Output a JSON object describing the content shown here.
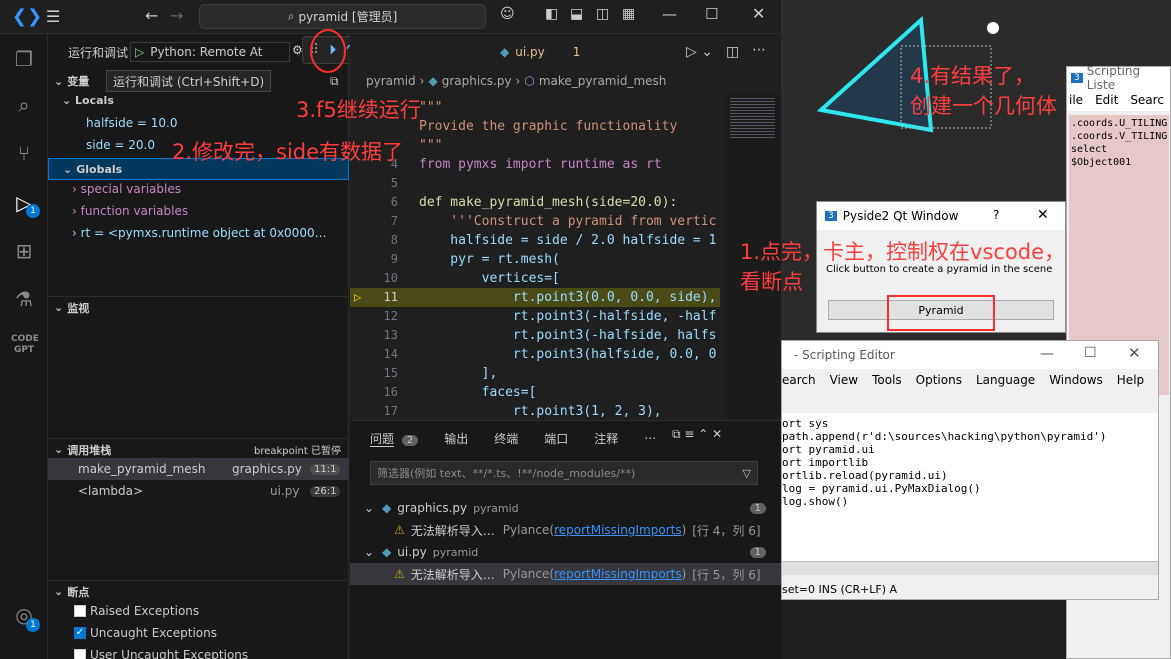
{
  "titlebar": {
    "search_text": "pyramid [管理员]"
  },
  "debug": {
    "run_label": "运行和调试",
    "config": "Python: Remote At",
    "tooltip": "运行和调试 (Ctrl+Shift+D)"
  },
  "variables": {
    "title": "变量",
    "locals_title": "Locals",
    "halfside": "halfside = 10.0",
    "side": "side = 20.0",
    "globals_title": "Globals",
    "special": "special variables",
    "function": "function variables",
    "rt": "rt = <pymxs.runtime object at 0x0000…"
  },
  "watch": {
    "title": "监视"
  },
  "callstack": {
    "title": "调用堆栈",
    "status": "breakpoint 已暂停",
    "frames": [
      {
        "name": "make_pyramid_mesh",
        "file": "graphics.py",
        "line": "11:1"
      },
      {
        "name": "<lambda>",
        "file": "ui.py",
        "line": "26:1"
      }
    ]
  },
  "breakpoints": {
    "title": "断点",
    "items": [
      "Raised Exceptions",
      "Uncaught Exceptions",
      "User Uncaught Exceptions"
    ]
  },
  "editor": {
    "tab": "ui.py",
    "tab_num": "1",
    "breadcrumb": [
      "pyramid",
      "graphics.py",
      "make_pyramid_mesh"
    ],
    "lines": [
      {
        "n": "",
        "t": "\"\"\""
      },
      {
        "n": "",
        "t": "Provide the graphic functionality"
      },
      {
        "n": "",
        "t": "\"\"\""
      },
      {
        "n": "4",
        "t": "from pymxs import runtime as rt"
      },
      {
        "n": "5",
        "t": ""
      },
      {
        "n": "6",
        "t": "def make_pyramid_mesh(side=20.0):"
      },
      {
        "n": "7",
        "t": "    '''Construct a pyramid from vertic"
      },
      {
        "n": "8",
        "t": "    halfside = side / 2.0 halfside = 1"
      },
      {
        "n": "9",
        "t": "    pyr = rt.mesh("
      },
      {
        "n": "10",
        "t": "        vertices=["
      },
      {
        "n": "11",
        "t": "            rt.point3(0.0, 0.0, side),"
      },
      {
        "n": "12",
        "t": "            rt.point3(-halfside, -half"
      },
      {
        "n": "13",
        "t": "            rt.point3(-halfside, halfs"
      },
      {
        "n": "14",
        "t": "            rt.point3(halfside, 0.0, 0"
      },
      {
        "n": "15",
        "t": "        ],"
      },
      {
        "n": "16",
        "t": "        faces=["
      },
      {
        "n": "17",
        "t": "            rt.point3(1, 2, 3),"
      }
    ]
  },
  "panel": {
    "tabs": [
      "问题",
      "输出",
      "终端",
      "端口",
      "注释"
    ],
    "badge": "2",
    "filter": "筛选器(例如 text、**/*.ts、!**/node_modules/**)",
    "groups": [
      {
        "file": "graphics.py",
        "folder": "pyramid",
        "count": "1",
        "msg": "无法解析导入…",
        "src": "Pylance",
        "code": "reportMissingImports",
        "pos": "[行 4，列 6]"
      },
      {
        "file": "ui.py",
        "folder": "pyramid",
        "count": "1",
        "msg": "无法解析导入…",
        "src": "Pylance",
        "code": "reportMissingImports",
        "pos": "[行 5，列 6]"
      }
    ]
  },
  "pyside": {
    "title": "Pyside2 Qt Window",
    "help": "?",
    "hint": "Click button to create a pyramid in the scene",
    "button": "Pyramid"
  },
  "listener": {
    "title": "Scripting Liste",
    "menu": [
      "ile",
      "Edit",
      "Searc"
    ],
    "lines": [
      ".coords.U_TILING",
      ".coords.V_TILING",
      "select $Object001"
    ]
  },
  "script_editor": {
    "title": "- Scripting Editor",
    "menu": [
      "earch",
      "View",
      "Tools",
      "Options",
      "Language",
      "Windows",
      "Help"
    ],
    "code": [
      "ort sys",
      " path.append(r'd:\\sources\\hacking\\python\\pyramid')",
      "ort pyramid.ui",
      "ort importlib",
      "ortlib.reload(pyramid.ui)",
      "log = pyramid.ui.PyMaxDialog()",
      "log.show()"
    ],
    "status": "set=0 INS (CR+LF) A"
  },
  "annotations": {
    "a1": "1.点完，卡主，控制权在vscode，",
    "a1b": "看断点",
    "a2": "2.修改完，side有数据了",
    "a3": "3.f5继续运行",
    "a4": "4.有结果了，",
    "a4b": "创建一个几何体"
  },
  "colors": {
    "accent": "#0078d4",
    "annotation": "#ff3d3d"
  }
}
